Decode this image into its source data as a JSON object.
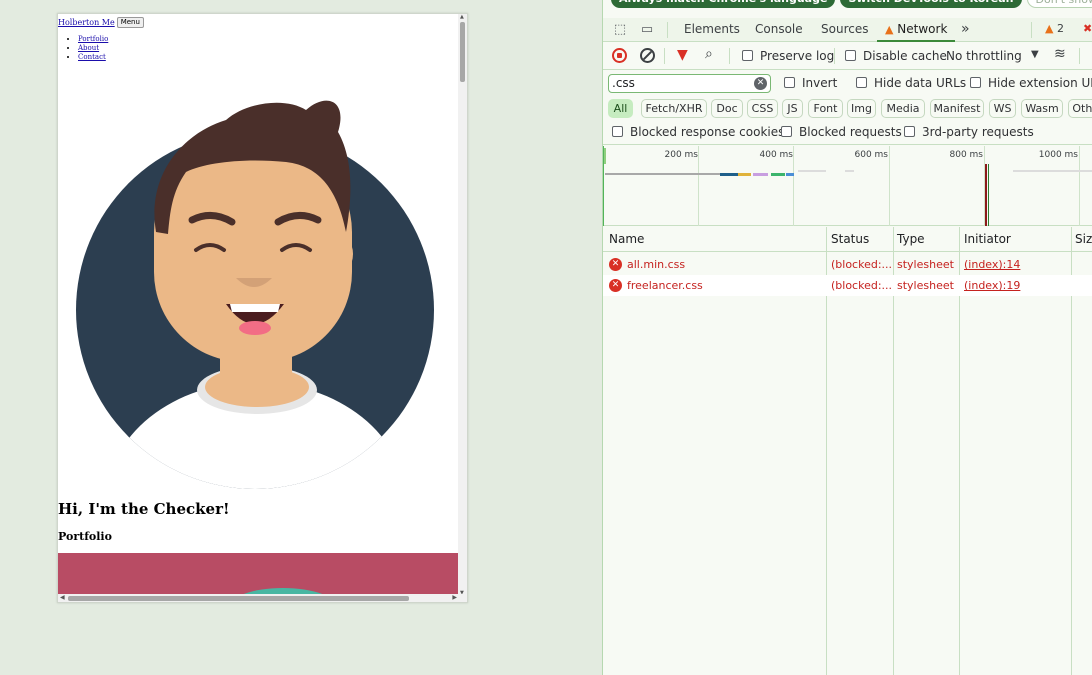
{
  "page": {
    "brand": "Holberton Me",
    "menu_button": "Menu",
    "nav_links": [
      "Portfolio",
      "About",
      "Contact"
    ],
    "hero_title": "Hi, I'm the Checker!",
    "section_title": "Portfolio"
  },
  "devtools": {
    "top_chips": [
      "Always match Chrome's language",
      "Switch DevTools to Korean",
      "Don't show again"
    ],
    "tabs": [
      "Elements",
      "Console",
      "Sources",
      "Network"
    ],
    "active_tab": "Network",
    "more_tabs_icon": "double-chevron-right-icon",
    "issues_count": "2",
    "toolbar": {
      "preserve_log": "Preserve log",
      "disable_cache": "Disable cache",
      "throttling": "No throttling"
    },
    "filter": {
      "value": ".css",
      "invert": "Invert",
      "hide_data_urls": "Hide data URLs",
      "hide_extension_urls": "Hide extension URLs"
    },
    "type_filters": [
      "All",
      "Fetch/XHR",
      "Doc",
      "CSS",
      "JS",
      "Font",
      "Img",
      "Media",
      "Manifest",
      "WS",
      "Wasm",
      "Other"
    ],
    "active_type_filter": "All",
    "blocked_filters": [
      "Blocked response cookies",
      "Blocked requests",
      "3rd-party requests"
    ],
    "timeline_ticks": [
      "200 ms",
      "400 ms",
      "600 ms",
      "800 ms",
      "1000 ms"
    ],
    "columns": [
      "Name",
      "Status",
      "Type",
      "Initiator",
      "Size"
    ],
    "requests": [
      {
        "name": "all.min.css",
        "status": "(blocked:...",
        "type": "stylesheet",
        "initiator": "(index):14"
      },
      {
        "name": "freelancer.css",
        "status": "(blocked:...",
        "type": "stylesheet",
        "initiator": "(index):19"
      }
    ],
    "colors": {
      "accent": "#3c8a3a",
      "error": "#d93025",
      "panel_bg": "#f7faf4"
    }
  }
}
